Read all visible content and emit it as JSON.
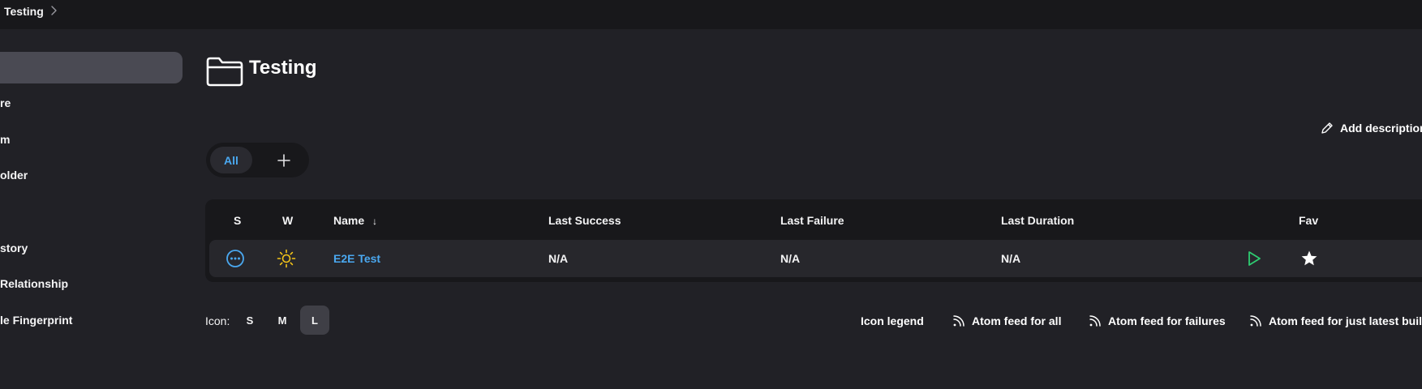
{
  "breadcrumb": {
    "current": "Testing"
  },
  "sidebar": {
    "items": [
      {
        "label": ""
      },
      {
        "label": "re"
      },
      {
        "label": "m"
      },
      {
        "label": "older"
      },
      {
        "label": ""
      },
      {
        "label": "story"
      },
      {
        "label": "Relationship"
      },
      {
        "label": "le Fingerprint"
      }
    ]
  },
  "page": {
    "title": "Testing",
    "add_description": "Add description"
  },
  "views": {
    "tabs": [
      {
        "label": "All"
      }
    ],
    "add_icon": "plus-icon"
  },
  "table": {
    "headers": {
      "status": "S",
      "weather": "W",
      "name": "Name",
      "name_sort_indicator": "↓",
      "last_success": "Last Success",
      "last_failure": "Last Failure",
      "last_duration": "Last Duration",
      "fav": "Fav"
    },
    "rows": [
      {
        "status_icon": "in-progress-icon",
        "weather_icon": "sunny-icon",
        "name": "E2E Test",
        "last_success": "N/A",
        "last_failure": "N/A",
        "last_duration": "N/A",
        "run_icon": "play-icon",
        "fav_icon": "star-icon"
      }
    ]
  },
  "footer": {
    "icon_label": "Icon:",
    "sizes": [
      "S",
      "M",
      "L"
    ],
    "selected_size": "L",
    "icon_legend": "Icon legend",
    "feed_all": "Atom feed for all",
    "feed_failures": "Atom feed for failures",
    "feed_latest": "Atom feed for just latest builds"
  },
  "colors": {
    "background": "#212126",
    "panel": "#18181b",
    "accent": "#4aa8f0",
    "success_green": "#2ecc71",
    "weather_yellow": "#f5c518"
  }
}
